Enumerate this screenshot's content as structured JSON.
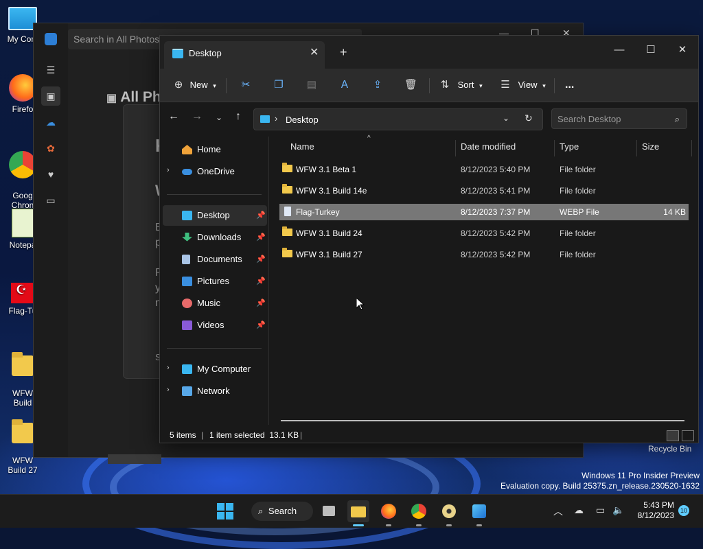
{
  "desktop": {
    "icons": [
      {
        "label": "My Com",
        "kind": "computer"
      },
      {
        "label": "Firefo",
        "kind": "firefox"
      },
      {
        "label": "Goog\nChron",
        "kind": "chrome"
      },
      {
        "label": "Notepa",
        "kind": "notepad"
      },
      {
        "label": "Flag-Tu",
        "kind": "flag"
      },
      {
        "label": "WFW\nBuild",
        "kind": "folder"
      },
      {
        "label": "WFW\nBuild 27",
        "kind": "folder"
      }
    ],
    "recycle_bin_label": "Recycle Bin",
    "watermark_line1": "Windows 11 Pro Insider Preview",
    "watermark_line2": "Evaluation copy. Build 25375.zn_release.230520-1632"
  },
  "photos": {
    "search_placeholder": "Search in All Photos",
    "heading": "All Ph",
    "card_letters": [
      "K",
      "W",
      "B",
      "p",
      "R",
      "y",
      "n",
      "S"
    ]
  },
  "explorer": {
    "tab_title": "Desktop",
    "toolbar": {
      "new_label": "New",
      "sort_label": "Sort",
      "view_label": "View",
      "more_label": "..."
    },
    "address": {
      "current": "Desktop"
    },
    "search_placeholder": "Search Desktop",
    "nav": {
      "home": "Home",
      "onedrive": "OneDrive",
      "quick": [
        {
          "label": "Desktop",
          "icon": "desktop-icon",
          "color": "#3ab6f0"
        },
        {
          "label": "Downloads",
          "icon": "download-icon",
          "color": "#3fbf7f"
        },
        {
          "label": "Documents",
          "icon": "documents-icon",
          "color": "#a9c4e6"
        },
        {
          "label": "Pictures",
          "icon": "pictures-icon",
          "color": "#3a8fe0"
        },
        {
          "label": "Music",
          "icon": "music-icon",
          "color": "#e86a6a"
        },
        {
          "label": "Videos",
          "icon": "videos-icon",
          "color": "#8a5ad8"
        }
      ],
      "my_computer": "My Computer",
      "network": "Network"
    },
    "columns": {
      "name": "Name",
      "date": "Date modified",
      "type": "Type",
      "size": "Size"
    },
    "files": [
      {
        "name": "WFW 3.1 Beta 1",
        "date": "8/12/2023 5:40 PM",
        "type": "File folder",
        "size": "",
        "kind": "folder"
      },
      {
        "name": "WFW 3.1 Build 14e",
        "date": "8/12/2023 5:41 PM",
        "type": "File folder",
        "size": "",
        "kind": "folder"
      },
      {
        "name": "Flag-Turkey",
        "date": "8/12/2023 7:37 PM",
        "type": "WEBP File",
        "size": "14 KB",
        "kind": "file"
      },
      {
        "name": "WFW 3.1 Build 24",
        "date": "8/12/2023 5:42 PM",
        "type": "File folder",
        "size": "",
        "kind": "folder"
      },
      {
        "name": "WFW 3.1 Build 27",
        "date": "8/12/2023 5:42 PM",
        "type": "File folder",
        "size": "",
        "kind": "folder"
      }
    ],
    "selected_file": "Flag-Turkey",
    "status": {
      "count": "5 items",
      "selection": "1 item selected  13.1 KB"
    }
  },
  "taskbar": {
    "search_label": "Search",
    "time": "5:43 PM",
    "date": "8/12/2023",
    "notification_count": "10"
  },
  "colors": {
    "accent": "#60cdff",
    "folder": "#f2c94c"
  }
}
